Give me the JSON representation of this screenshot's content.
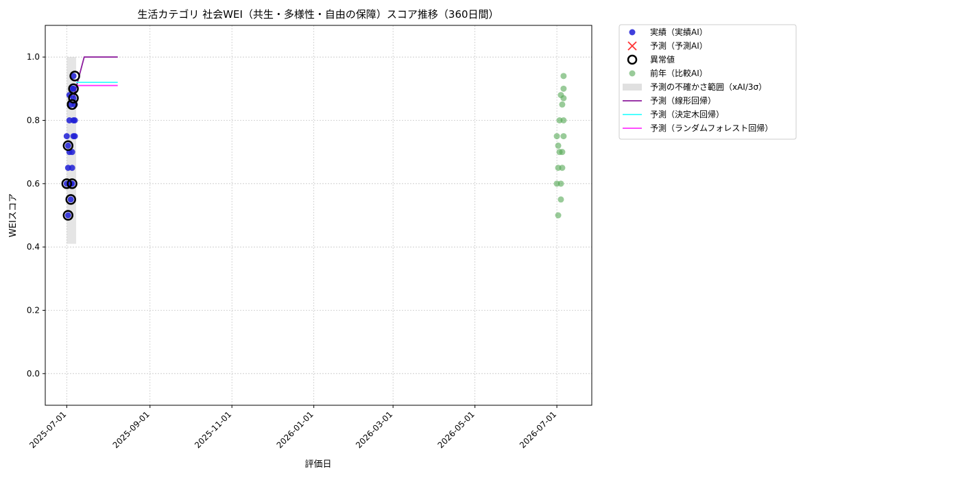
{
  "chart_data": {
    "type": "scatter",
    "title": "生活カテゴリ 社会WEI（共生・多様性・自由の保障）スコア推移（360日間）",
    "xlabel": "評価日",
    "ylabel": "WEIスコア",
    "x_range": [
      "2025-06-15",
      "2026-07-27"
    ],
    "ylim": [
      -0.1,
      1.1
    ],
    "y_ticks": [
      0.0,
      0.2,
      0.4,
      0.6,
      0.8,
      1.0
    ],
    "y_tick_labels": [
      "0.0",
      "0.2",
      "0.4",
      "0.6",
      "0.8",
      "1.0"
    ],
    "x_ticks": [
      "2025-07-01",
      "2025-09-01",
      "2025-11-01",
      "2026-01-01",
      "2026-03-01",
      "2026-05-01",
      "2026-07-01"
    ],
    "grid": true,
    "legend_position": "outside-right-top",
    "legend": [
      {
        "label": "実績（実績AI）",
        "kind": "dot",
        "color": "#1f1fd6"
      },
      {
        "label": "予測（予測AI）",
        "kind": "cross",
        "color": "#ff3333"
      },
      {
        "label": "異常値",
        "kind": "ring",
        "color": "#000000"
      },
      {
        "label": "前年（比較AI）",
        "kind": "dot",
        "color": "#55a855"
      },
      {
        "label": "予測の不確かさ範囲（xAI/3σ）",
        "kind": "band",
        "color": "#cccccc"
      },
      {
        "label": "予測（線形回帰）",
        "kind": "line",
        "color": "#8b1a9c"
      },
      {
        "label": "予測（決定木回帰）",
        "kind": "line",
        "color": "#33ffff"
      },
      {
        "label": "予測（ランダムフォレスト回帰）",
        "kind": "line",
        "color": "#ff33ff"
      }
    ],
    "series": [
      {
        "name": "実績（実績AI）",
        "kind": "scatter",
        "color": "#1f1fd6",
        "points": [
          [
            "2025-07-01",
            0.6
          ],
          [
            "2025-07-01",
            0.75
          ],
          [
            "2025-07-02",
            0.72
          ],
          [
            "2025-07-02",
            0.65
          ],
          [
            "2025-07-02",
            0.5
          ],
          [
            "2025-07-03",
            0.8
          ],
          [
            "2025-07-03",
            0.7
          ],
          [
            "2025-07-03",
            0.88
          ],
          [
            "2025-07-04",
            0.6
          ],
          [
            "2025-07-04",
            0.55
          ],
          [
            "2025-07-04",
            0.85
          ],
          [
            "2025-07-05",
            0.65
          ],
          [
            "2025-07-05",
            0.9
          ],
          [
            "2025-07-05",
            0.7
          ],
          [
            "2025-07-05",
            0.6
          ],
          [
            "2025-07-06",
            0.8
          ],
          [
            "2025-07-06",
            0.75
          ],
          [
            "2025-07-06",
            0.94
          ],
          [
            "2025-07-06",
            0.87
          ],
          [
            "2025-07-06",
            0.9
          ],
          [
            "2025-07-07",
            0.85
          ],
          [
            "2025-07-07",
            0.8
          ],
          [
            "2025-07-07",
            0.75
          ]
        ]
      },
      {
        "name": "異常値",
        "kind": "ring",
        "color": "#000000",
        "points": [
          [
            "2025-07-01",
            0.6
          ],
          [
            "2025-07-02",
            0.72
          ],
          [
            "2025-07-02",
            0.5
          ],
          [
            "2025-07-04",
            0.55
          ],
          [
            "2025-07-05",
            0.6
          ],
          [
            "2025-07-05",
            0.85
          ],
          [
            "2025-07-06",
            0.9
          ],
          [
            "2025-07-06",
            0.87
          ],
          [
            "2025-07-07",
            0.94
          ]
        ]
      },
      {
        "name": "前年（比較AI）",
        "kind": "scatter",
        "color": "#55a855",
        "points": [
          [
            "2026-07-01",
            0.75
          ],
          [
            "2026-07-01",
            0.6
          ],
          [
            "2026-07-02",
            0.72
          ],
          [
            "2026-07-02",
            0.65
          ],
          [
            "2026-07-02",
            0.5
          ],
          [
            "2026-07-03",
            0.8
          ],
          [
            "2026-07-03",
            0.7
          ],
          [
            "2026-07-04",
            0.88
          ],
          [
            "2026-07-04",
            0.55
          ],
          [
            "2026-07-04",
            0.6
          ],
          [
            "2026-07-05",
            0.65
          ],
          [
            "2026-07-05",
            0.85
          ],
          [
            "2026-07-05",
            0.7
          ],
          [
            "2026-07-06",
            0.8
          ],
          [
            "2026-07-06",
            0.75
          ],
          [
            "2026-07-06",
            0.9
          ],
          [
            "2026-07-06",
            0.87
          ],
          [
            "2026-07-06",
            0.94
          ]
        ]
      },
      {
        "name": "予測の不確かさ範囲（xAI/3σ）",
        "kind": "band",
        "color": "#cccccc",
        "x_start": "2025-07-01",
        "x_end": "2025-07-08",
        "y_low": 0.41,
        "y_high": 1.0
      },
      {
        "name": "予測（線形回帰）",
        "kind": "line",
        "color": "#8b1a9c",
        "points": [
          [
            "2025-07-06",
            0.87
          ],
          [
            "2025-07-09",
            0.92
          ],
          [
            "2025-07-14",
            1.0
          ],
          [
            "2025-08-08",
            1.0
          ]
        ]
      },
      {
        "name": "予測（決定木回帰）",
        "kind": "line",
        "color": "#33ffff",
        "points": [
          [
            "2025-07-08",
            0.92
          ],
          [
            "2025-08-08",
            0.92
          ]
        ]
      },
      {
        "name": "予測（ランダムフォレスト回帰）",
        "kind": "line",
        "color": "#ff33ff",
        "points": [
          [
            "2025-07-08",
            0.91
          ],
          [
            "2025-08-08",
            0.91
          ]
        ]
      }
    ]
  }
}
